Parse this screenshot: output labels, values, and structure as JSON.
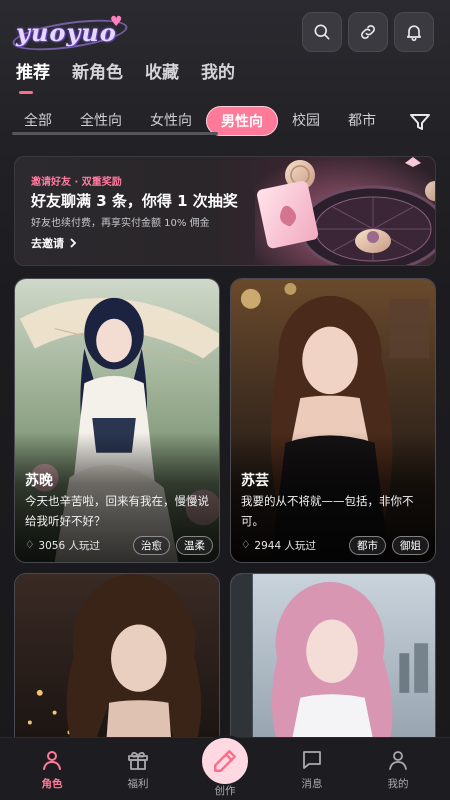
{
  "app": {
    "logo_text": "yuoyuo"
  },
  "main_tabs": [
    {
      "label": "推荐",
      "active": true
    },
    {
      "label": "新角色",
      "active": false
    },
    {
      "label": "收藏",
      "active": false
    },
    {
      "label": "我的",
      "active": false
    }
  ],
  "categories": [
    {
      "label": "全部",
      "active": false
    },
    {
      "label": "全性向",
      "active": false
    },
    {
      "label": "女性向",
      "active": false
    },
    {
      "label": "男性向",
      "active": true
    },
    {
      "label": "校园",
      "active": false
    },
    {
      "label": "都市",
      "active": false
    }
  ],
  "banner": {
    "tag": "邀请好友 · 双重奖励",
    "title": "好友聊满 3 条，你得 1 次抽奖",
    "subtitle": "好友也续付费，再享实付金额 10% 佣金",
    "cta": "去邀请"
  },
  "cards": [
    {
      "name": "苏晚",
      "description": "今天也辛苦啦，回来有我在，慢慢说给我听好不好？",
      "plays": "3056 人玩过",
      "tags": [
        "治愈",
        "温柔"
      ]
    },
    {
      "name": "苏芸",
      "description": "我要的从不将就——包括，非你不可。",
      "plays": "2944 人玩过",
      "tags": [
        "都市",
        "御姐"
      ]
    },
    {
      "name": "",
      "description": "",
      "plays": "",
      "tags": []
    },
    {
      "name": "",
      "description": "",
      "plays": "",
      "tags": []
    }
  ],
  "bottom_nav": [
    {
      "label": "角色",
      "icon": "person-icon",
      "active": true
    },
    {
      "label": "福利",
      "icon": "gift-icon",
      "active": false
    },
    {
      "label": "创作",
      "icon": "pen-icon",
      "active": false
    },
    {
      "label": "消息",
      "icon": "message-icon",
      "active": false
    },
    {
      "label": "我的",
      "icon": "profile-icon",
      "active": false
    }
  ],
  "colors": {
    "accent": "#ff7a98",
    "background": "#1a1a1d"
  }
}
